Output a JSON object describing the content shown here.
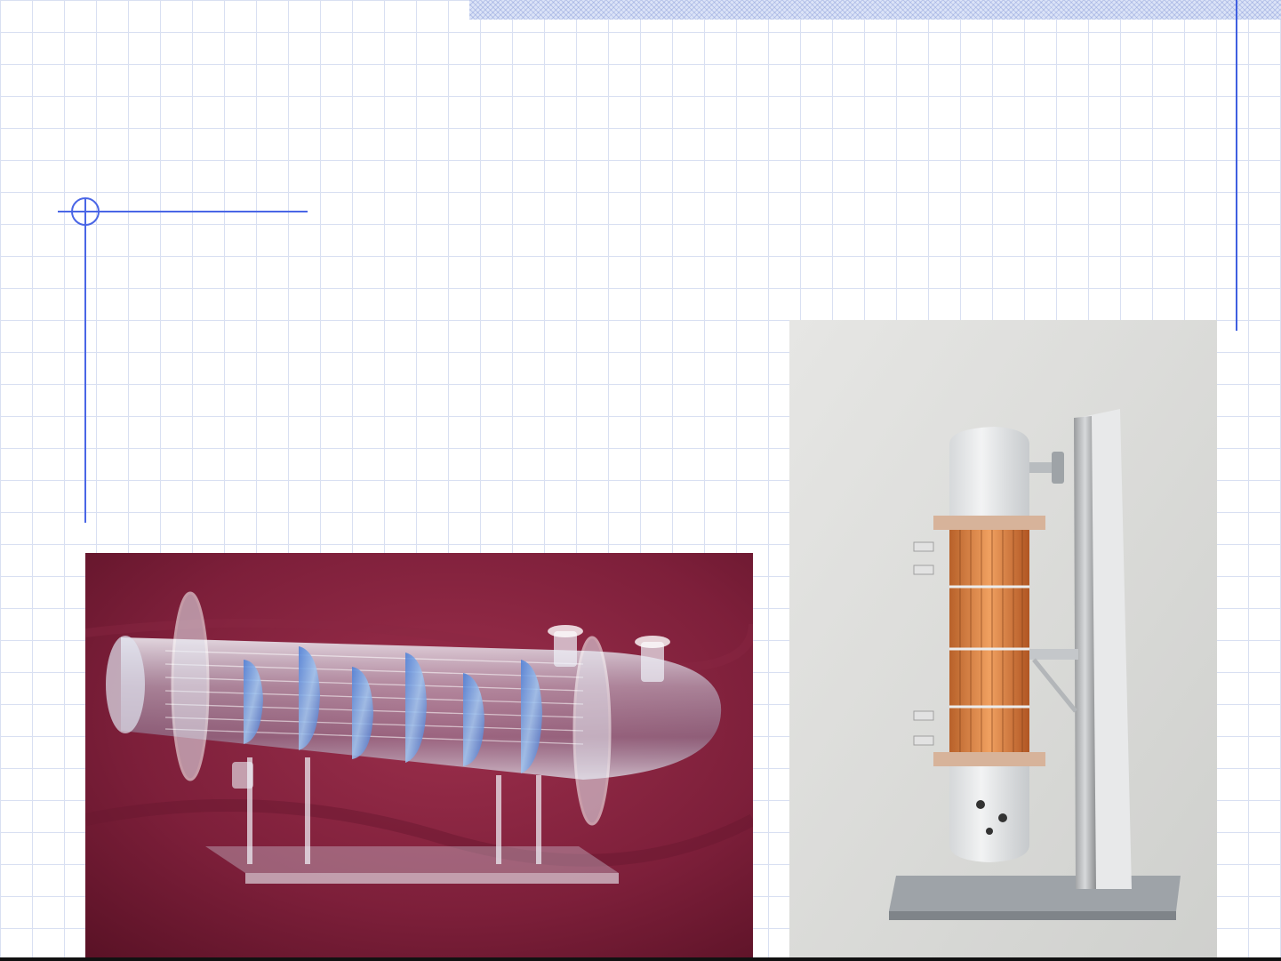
{
  "slide": {
    "title": "",
    "body": ""
  },
  "theme": {
    "grid_color": "#d9e0f2",
    "accent": "#3f5fe0",
    "band_color": "#dbe3f7"
  },
  "images": [
    {
      "name": "horizontal-shell-and-tube-heat-exchanger-model"
    },
    {
      "name": "vertical-shell-and-tube-heat-exchanger-model"
    }
  ]
}
